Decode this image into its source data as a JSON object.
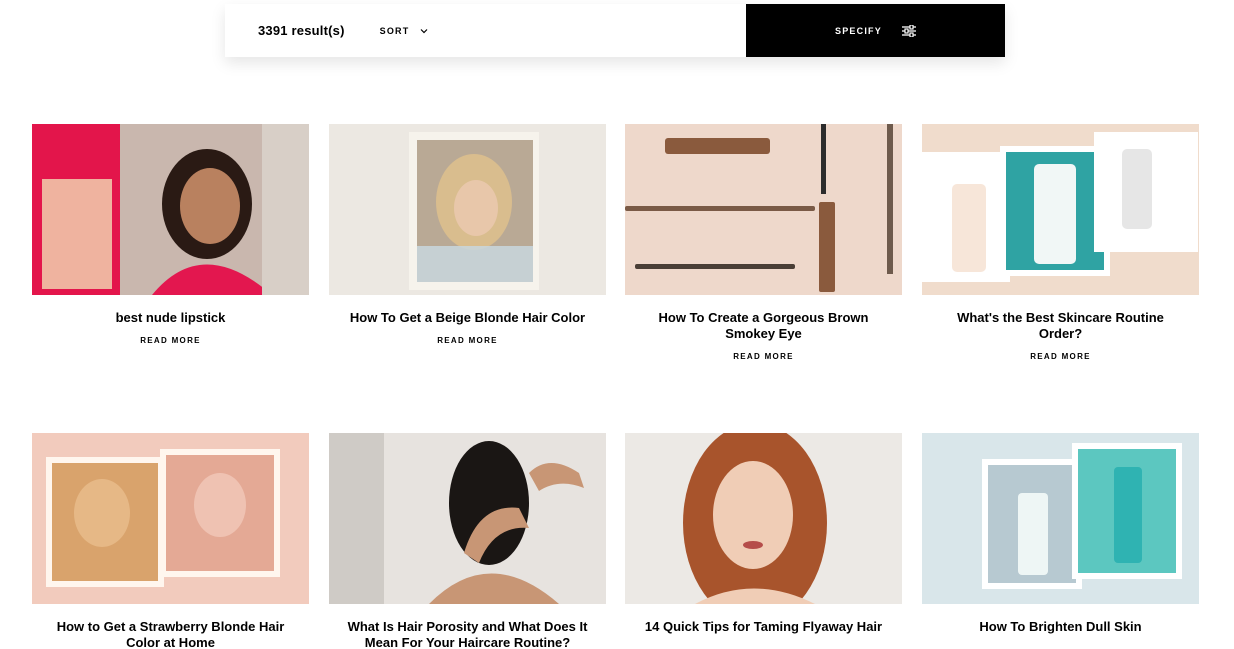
{
  "filter": {
    "results": "3391 result(s)",
    "sort_label": "SORT",
    "specify_label": "SPECIFY"
  },
  "articles": [
    {
      "title": "best nude lipstick",
      "read_more": "READ MORE"
    },
    {
      "title": "How To Get a Beige Blonde Hair Color",
      "read_more": "READ MORE"
    },
    {
      "title": "How To Create a Gorgeous Brown Smokey Eye",
      "read_more": "READ MORE"
    },
    {
      "title": "What's the Best Skincare Routine Order?",
      "read_more": "READ MORE"
    },
    {
      "title": "How to Get a Strawberry Blonde Hair Color at Home"
    },
    {
      "title": "What Is Hair Porosity and What Does It Mean For Your Haircare Routine?"
    },
    {
      "title": "14 Quick Tips for Taming Flyaway Hair"
    },
    {
      "title": "How To Brighten Dull Skin"
    }
  ]
}
